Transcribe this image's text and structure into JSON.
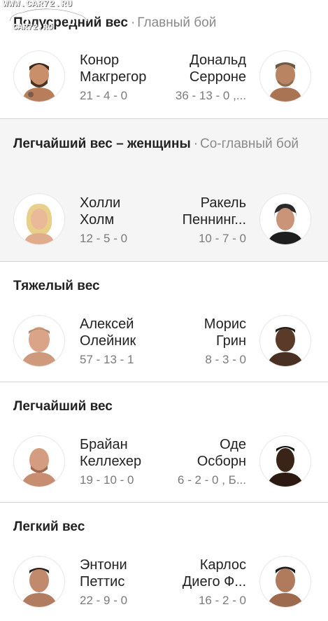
{
  "watermark": {
    "line1": "WWW.CAR72.RU",
    "line2": "CAR72.RO"
  },
  "fights": [
    {
      "weight_class": "Полусредний вес",
      "separator": "·",
      "bout_type": "Главный бой",
      "red": {
        "first": "Конор",
        "last": "Макгрегор",
        "record": "21 - 4 - 0"
      },
      "blue": {
        "first": "Дональд",
        "last": "Серроне",
        "record": "36 - 13 - 0 ,..."
      }
    },
    {
      "weight_class": "Легчайший вес – женщины",
      "separator": "·",
      "bout_type": "Со-главный бой",
      "red": {
        "first": "Холли",
        "last": "Холм",
        "record": "12 - 5 - 0"
      },
      "blue": {
        "first": "Ракель",
        "last": "Пеннинг...",
        "record": "10 - 7 - 0"
      }
    },
    {
      "weight_class": "Тяжелый вес",
      "separator": "",
      "bout_type": "",
      "red": {
        "first": "Алексей",
        "last": "Олейник",
        "record": "57 - 13 - 1"
      },
      "blue": {
        "first": "Морис",
        "last": "Грин",
        "record": "8 - 3 - 0"
      }
    },
    {
      "weight_class": "Легчайший вес",
      "separator": "",
      "bout_type": "",
      "red": {
        "first": "Брайан",
        "last": "Келлехер",
        "record": "19 - 10 - 0"
      },
      "blue": {
        "first": "Оде",
        "last": "Осборн",
        "record": "6 - 2 - 0 , Б..."
      }
    },
    {
      "weight_class": "Легкий вес",
      "separator": "",
      "bout_type": "",
      "red": {
        "first": "Энтони",
        "last": "Петтис",
        "record": "22 - 9 - 0"
      },
      "blue": {
        "first": "Карлос",
        "last": "Диего Ф...",
        "record": "16 - 2 - 0"
      }
    }
  ],
  "colors": {
    "divider": "#d6d6d6",
    "highlight_bg": "#f5f5f5",
    "record_text": "#7a7a7a",
    "bout_type_text": "#8a8a8a"
  },
  "icons": {
    "avatar": "fighter-portrait-icon",
    "watermark_car": "car-icon"
  }
}
